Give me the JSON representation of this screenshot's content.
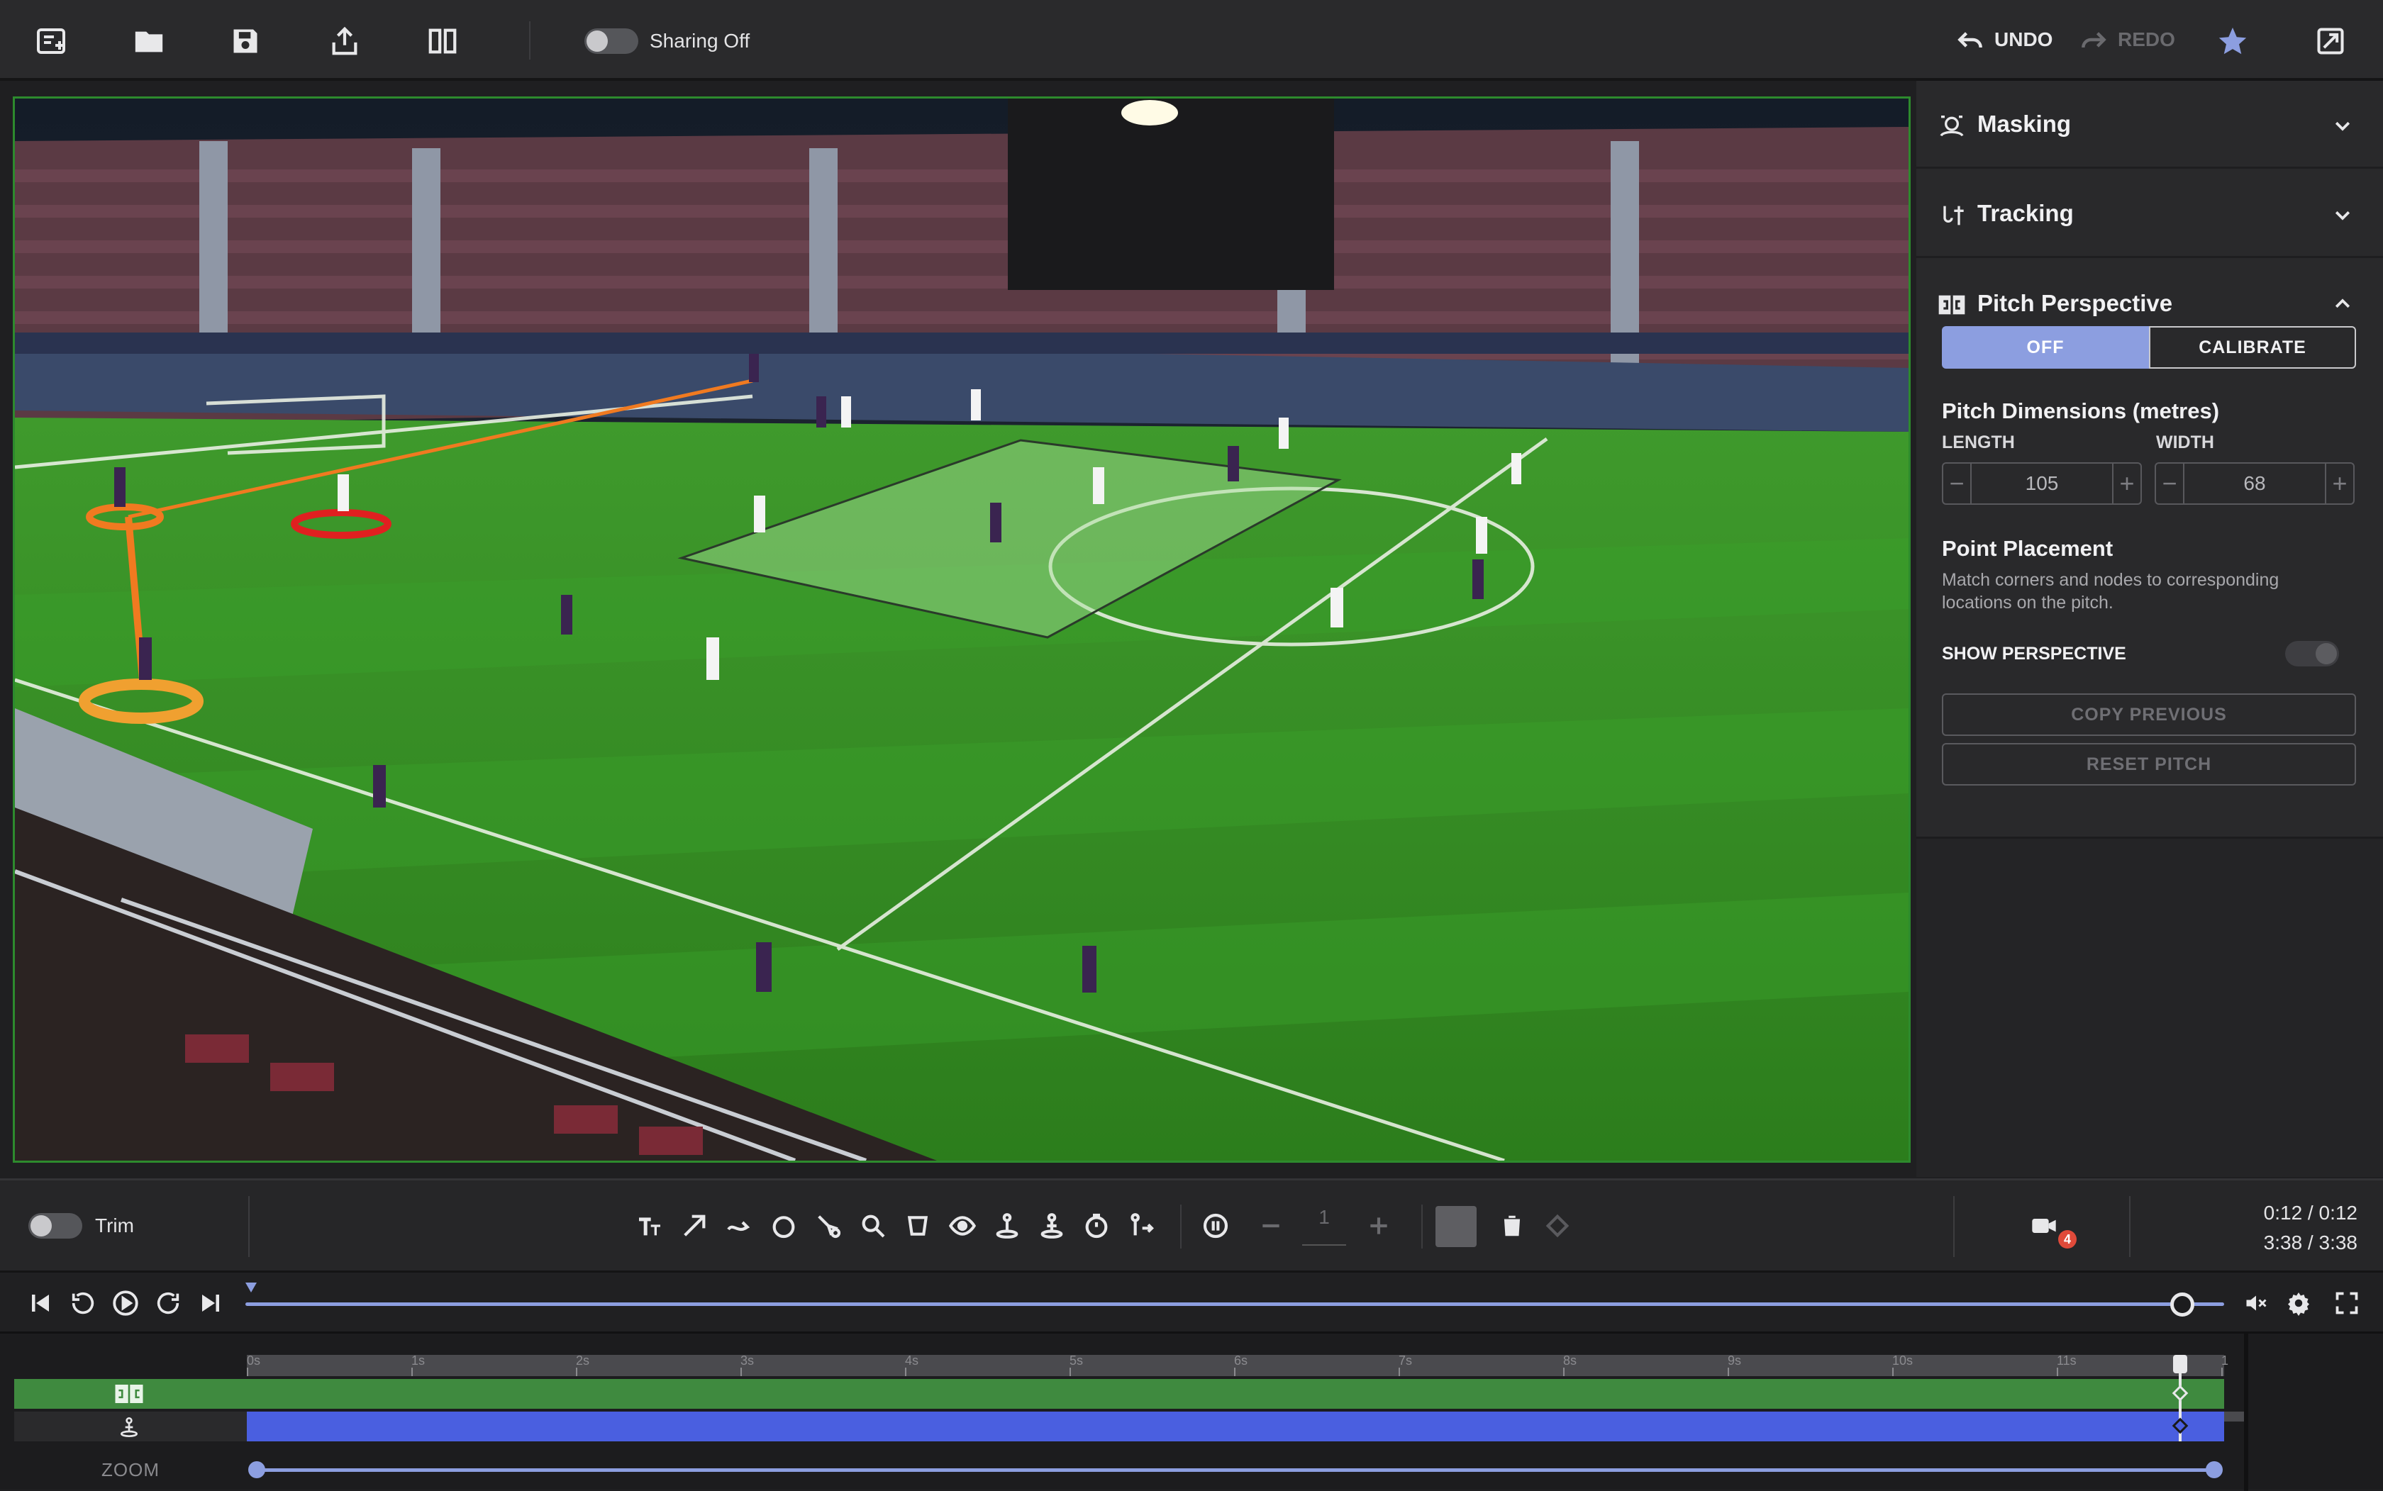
{
  "toolbar": {
    "sharing_label": "Sharing Off",
    "undo_label": "UNDO",
    "redo_label": "REDO",
    "icons": [
      "new-project-icon",
      "folder-icon",
      "save-icon",
      "export-icon",
      "split-view-icon",
      "star-icon",
      "detach-icon"
    ]
  },
  "panel": {
    "masking": {
      "title": "Masking"
    },
    "tracking": {
      "title": "Tracking"
    },
    "pitch": {
      "title": "Pitch Perspective",
      "off_label": "OFF",
      "calibrate_label": "CALIBRATE",
      "dimensions_title": "Pitch Dimensions (metres)",
      "length_label": "LENGTH",
      "width_label": "WIDTH",
      "length_value": "105",
      "width_value": "68",
      "placement_title": "Point Placement",
      "placement_desc_1": "Match corners and nodes to corresponding",
      "placement_desc_2": "locations on the pitch.",
      "show_perspective_label": "SHOW PERSPECTIVE",
      "copy_previous_label": "COPY PREVIOUS",
      "reset_pitch_label": "RESET PITCH"
    }
  },
  "tools": {
    "trim_label": "Trim",
    "count_value": "1",
    "camera_badge": "4",
    "time_clip": "0:12 / 0:12",
    "time_total": "3:38 / 3:38"
  },
  "timeline": {
    "ticks": [
      "0s",
      "1s",
      "2s",
      "3s",
      "4s",
      "5s",
      "6s",
      "7s",
      "8s",
      "9s",
      "10s",
      "11s",
      "1"
    ],
    "zoom_label": "ZOOM",
    "playhead_fraction": 0.985
  },
  "colors": {
    "accent": "#8c9ee0",
    "track_green": "#3f8a3f",
    "track_blue": "#4a5fe0",
    "pitch_green": "#2f8a25",
    "orange": "#f07a20",
    "red": "#e02020"
  }
}
